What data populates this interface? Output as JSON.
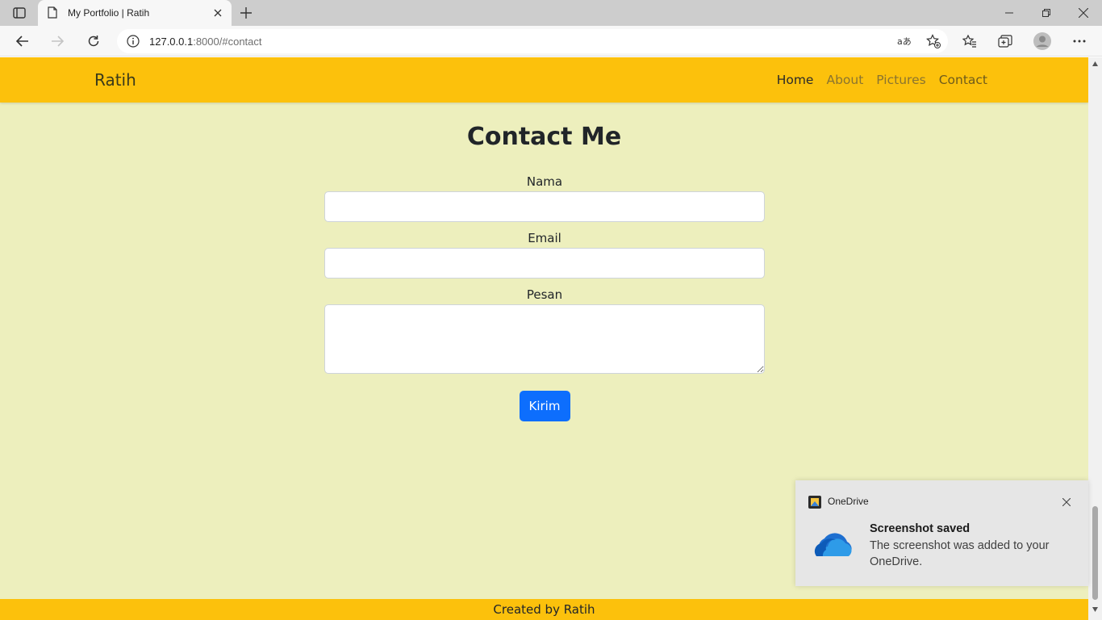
{
  "browser": {
    "tab_title": "My Portfolio | Ratih",
    "url_host": "127.0.0.1",
    "url_rest": ":8000/#contact"
  },
  "navbar": {
    "brand": "Ratih",
    "links": [
      "Home",
      "About",
      "Pictures",
      "Contact"
    ]
  },
  "contact": {
    "heading": "Contact Me",
    "name_label": "Nama",
    "email_label": "Email",
    "message_label": "Pesan",
    "submit_label": "Kirim"
  },
  "footer": {
    "text": "Created by Ratih"
  },
  "toast": {
    "app_name": "OneDrive",
    "title": "Screenshot saved",
    "body": "The screenshot was added to your OneDrive."
  },
  "colors": {
    "navbar_bg": "#fcc10c",
    "page_bg": "#edefbd",
    "button_bg": "#0d6efd"
  }
}
